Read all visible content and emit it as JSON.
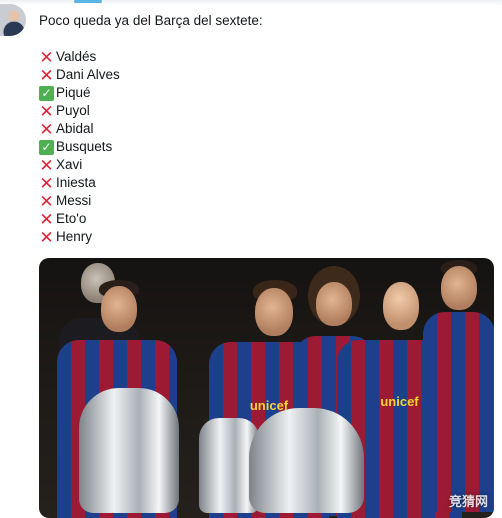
{
  "tweet": {
    "intro": "Poco queda ya del Barça del sextete:",
    "players": [
      {
        "name": "Valdés",
        "status": "cross"
      },
      {
        "name": "Dani Alves",
        "status": "cross"
      },
      {
        "name": "Piqué",
        "status": "check"
      },
      {
        "name": "Puyol",
        "status": "cross"
      },
      {
        "name": "Abidal",
        "status": "cross"
      },
      {
        "name": "Busquets",
        "status": "check"
      },
      {
        "name": "Xavi",
        "status": "cross"
      },
      {
        "name": "Iniesta",
        "status": "cross"
      },
      {
        "name": "Messi",
        "status": "cross"
      },
      {
        "name": "Eto'o",
        "status": "cross"
      },
      {
        "name": "Henry",
        "status": "cross"
      }
    ]
  },
  "photo": {
    "sponsor": "unicef",
    "watermark": "竞猜网"
  },
  "icons": {
    "cross": "cross-mark-icon",
    "check": "check-mark-icon"
  },
  "colors": {
    "cross": "#d9263b",
    "check": "#4fb053",
    "blaugrana_blue": "#1d3f8c",
    "blaugrana_red": "#9d1a34"
  }
}
